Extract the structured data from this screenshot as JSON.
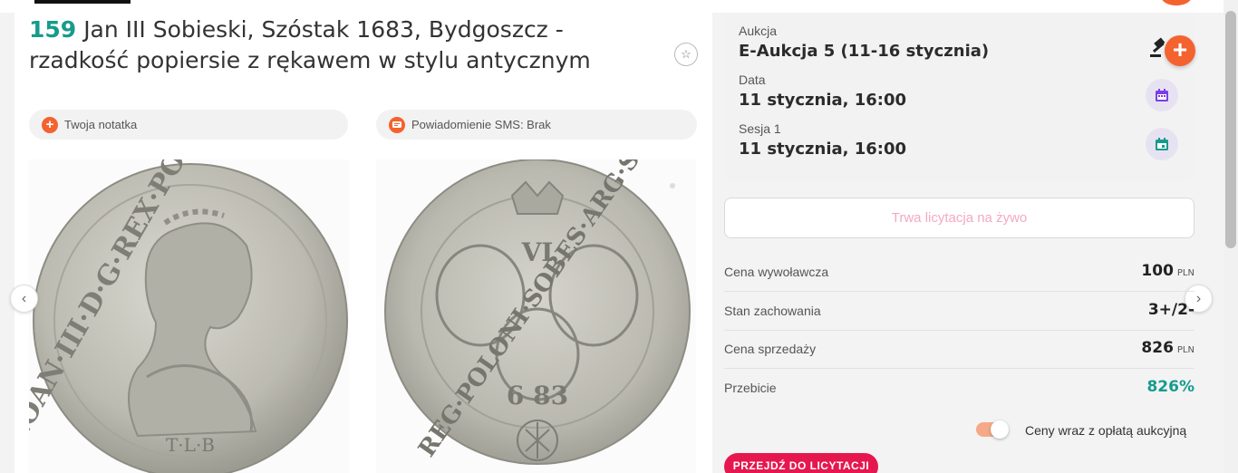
{
  "lot": {
    "number": "159",
    "title": "Jan III Sobieski, Szóstak 1683, Bydgoszcz - rzadkość popiersie z rękawem w stylu antycznym"
  },
  "actions": {
    "note_label": "Twoja notatka",
    "sms_label": "Powiadomienie SMS: Brak"
  },
  "auction_info": {
    "auction_label": "Aukcja",
    "auction_value": "E-Aukcja 5 (11-16 stycznia)",
    "date_label": "Data",
    "date_value": "11 stycznia, 16:00",
    "session_label": "Sesja 1",
    "session_value": "11 stycznia, 16:00"
  },
  "live_button": "Trwa licytacja na żywo",
  "prices": {
    "start_label": "Cena wywoławcza",
    "start_value": "100",
    "currency": "PLN",
    "condition_label": "Stan zachowania",
    "condition_value": "3+/2-",
    "sale_label": "Cena sprzedaży",
    "sale_value": "826",
    "overbid_label": "Przebicie",
    "overbid_value": "826%"
  },
  "toggle_label": "Ceny wraz z opłatą aukcyjną",
  "go_button": "PRZEJDŹ DO LICYTACJI",
  "coin": {
    "obverse_legend": "IOAN·III·D·G·REX·POL·M·D·L·R·P",
    "obverse_mark": "T·L·B",
    "reverse_legend": "REG·POLONI·SOBES·ARG·SEX",
    "reverse_year": "6 83",
    "reverse_value": "VI"
  },
  "colors": {
    "accent_orange": "#f4622f",
    "teal": "#169b8d",
    "pink_button": "#e5174e"
  }
}
